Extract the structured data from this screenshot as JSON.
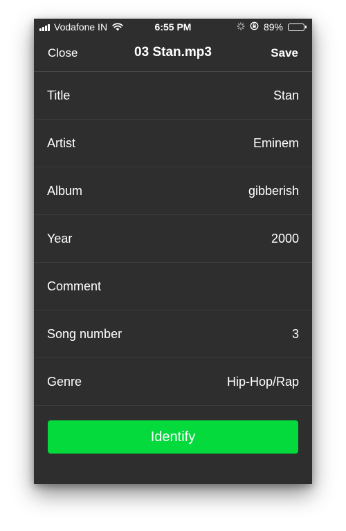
{
  "status_bar": {
    "carrier": "Vodafone IN",
    "time": "6:55 PM",
    "battery_percent_label": "89%",
    "battery_level": 0.89
  },
  "nav": {
    "close_label": "Close",
    "title": "03 Stan.mp3",
    "save_label": "Save"
  },
  "fields": [
    {
      "label": "Title",
      "value": "Stan"
    },
    {
      "label": "Artist",
      "value": "Eminem"
    },
    {
      "label": "Album",
      "value": "gibberish"
    },
    {
      "label": "Year",
      "value": "2000"
    },
    {
      "label": "Comment",
      "value": ""
    },
    {
      "label": "Song number",
      "value": "3"
    },
    {
      "label": "Genre",
      "value": "Hip-Hop/Rap"
    }
  ],
  "identify_button": {
    "label": "Identify"
  },
  "colors": {
    "background": "#2e2e2e",
    "accent_green": "#04da3c",
    "text": "#ffffff"
  }
}
